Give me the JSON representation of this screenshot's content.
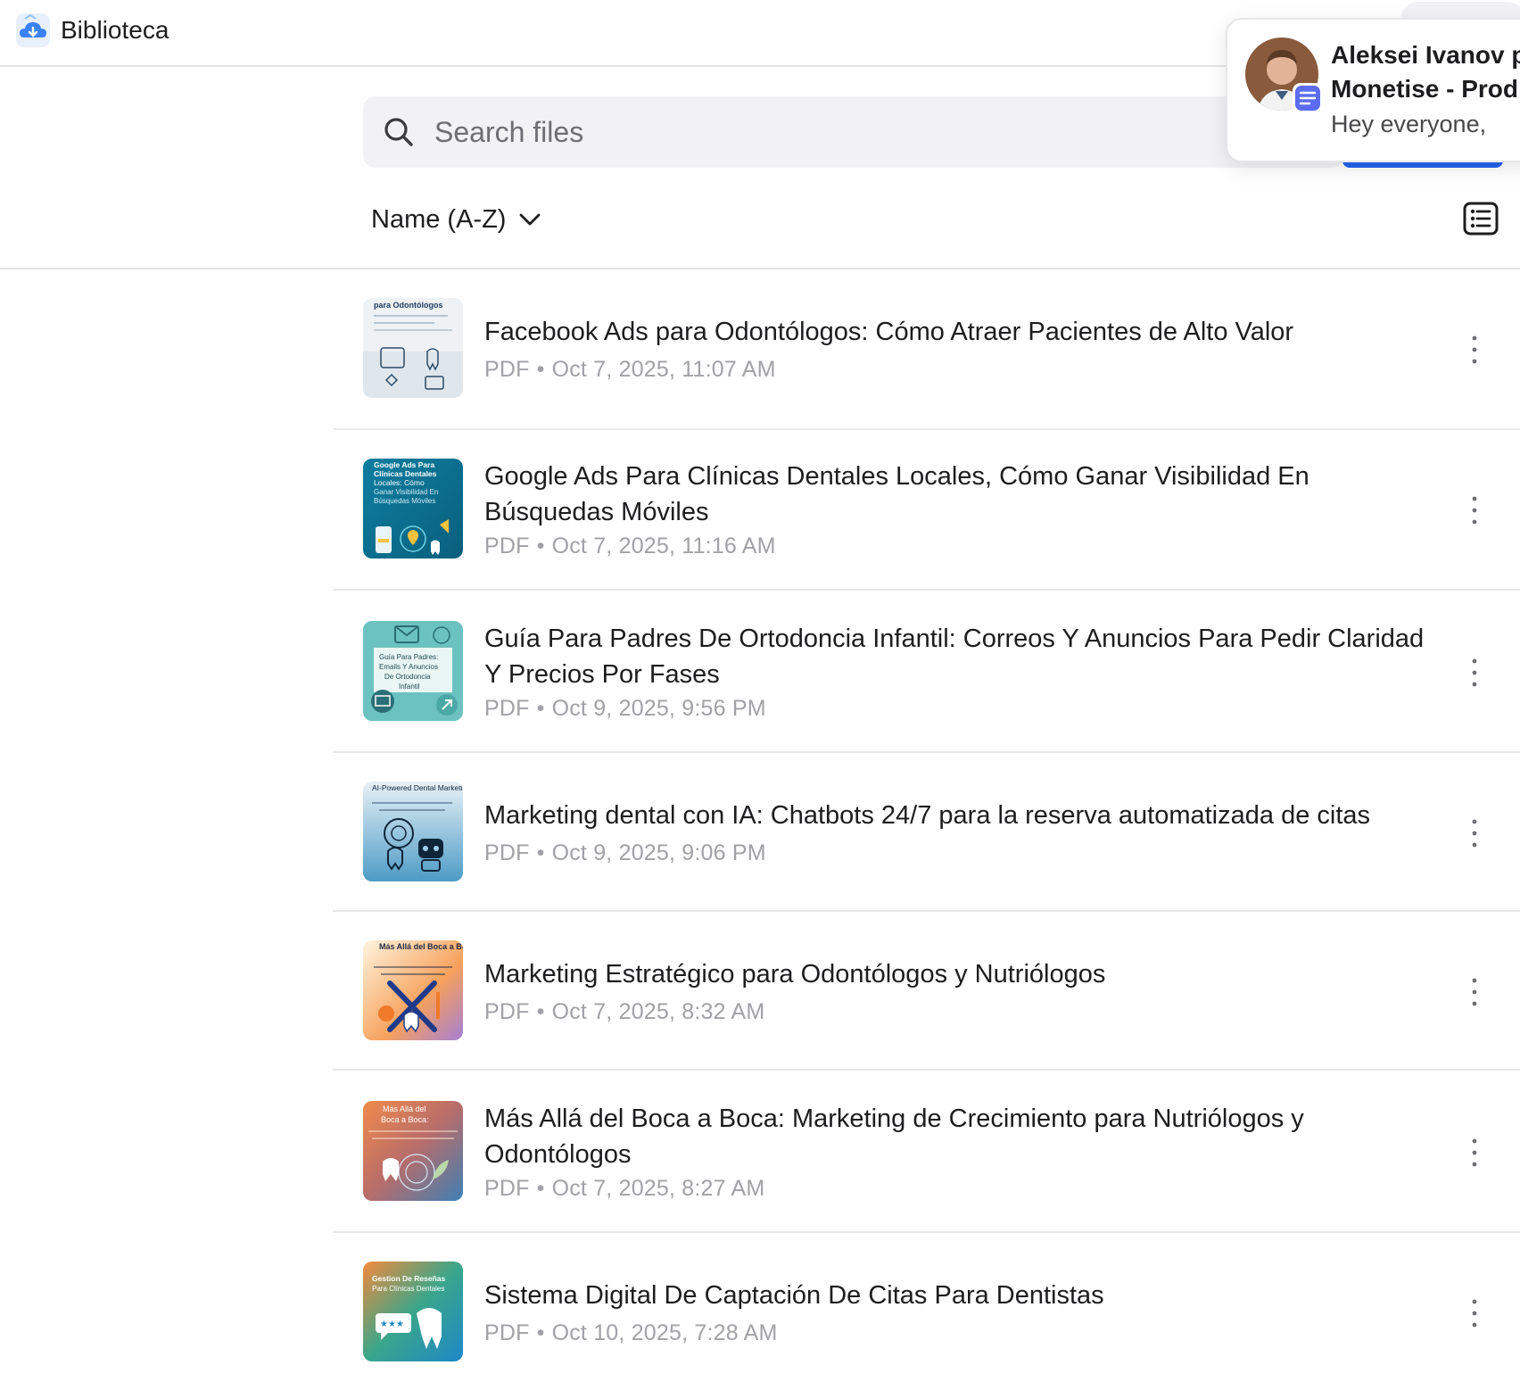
{
  "app": {
    "title": "Biblioteca"
  },
  "search": {
    "placeholder": "Search files",
    "value": ""
  },
  "sort": {
    "label": "Name (A-Z)"
  },
  "files": [
    {
      "title": "Facebook Ads para Odontólogos: Cómo Atraer Pacientes de Alto Valor",
      "type": "PDF",
      "date": "Oct 7, 2025, 11:07 AM",
      "thumb_text": "para Odontólogos"
    },
    {
      "title": "Google Ads Para Clínicas Dentales Locales, Cómo Ganar Visibilidad En Búsquedas Móviles",
      "type": "PDF",
      "date": "Oct 7, 2025, 11:16 AM",
      "thumb_text": "Google Ads Para Clínicas Dentales Locales: Cómo Ganar Visibilidad En Búsquedas Móviles"
    },
    {
      "title": "Guía Para Padres De Ortodoncia Infantil: Correos Y Anuncios Para Pedir Claridad Y Precios Por Fases",
      "type": "PDF",
      "date": "Oct 9, 2025, 9:56 PM",
      "thumb_text": "Guía Para Padres: Emails Y Anuncios De Ortodoncia Infantil"
    },
    {
      "title": "Marketing dental con IA: Chatbots 24/7 para la reserva automatizada de citas",
      "type": "PDF",
      "date": "Oct 9, 2025, 9:06 PM",
      "thumb_text": "AI-Powered Dental Marketing:"
    },
    {
      "title": "Marketing Estratégico para Odontólogos y Nutriólogos",
      "type": "PDF",
      "date": "Oct 7, 2025, 8:32 AM",
      "thumb_text": "Más Allá del Boca a Boca:"
    },
    {
      "title": "Más Allá del Boca a Boca: Marketing de Crecimiento para Nutriólogos y Odontólogos",
      "type": "PDF",
      "date": "Oct 7, 2025, 8:27 AM",
      "thumb_text": "Más Allá del Boca a Boca:"
    },
    {
      "title": "Sistema Digital De Captación De Citas Para Dentistas",
      "type": "PDF",
      "date": "Oct 10, 2025, 7:28 AM",
      "thumb_text": "Gestion De Reseñas Para Clínicas Dentales"
    }
  ],
  "notification": {
    "name": "Aleksei Ivanov p",
    "channel": "Monetise - Prod",
    "message": "Hey everyone,"
  },
  "colors": {
    "accent": "#2563eb",
    "meta": "#a1a1a6",
    "divider": "#e8e8eb"
  }
}
